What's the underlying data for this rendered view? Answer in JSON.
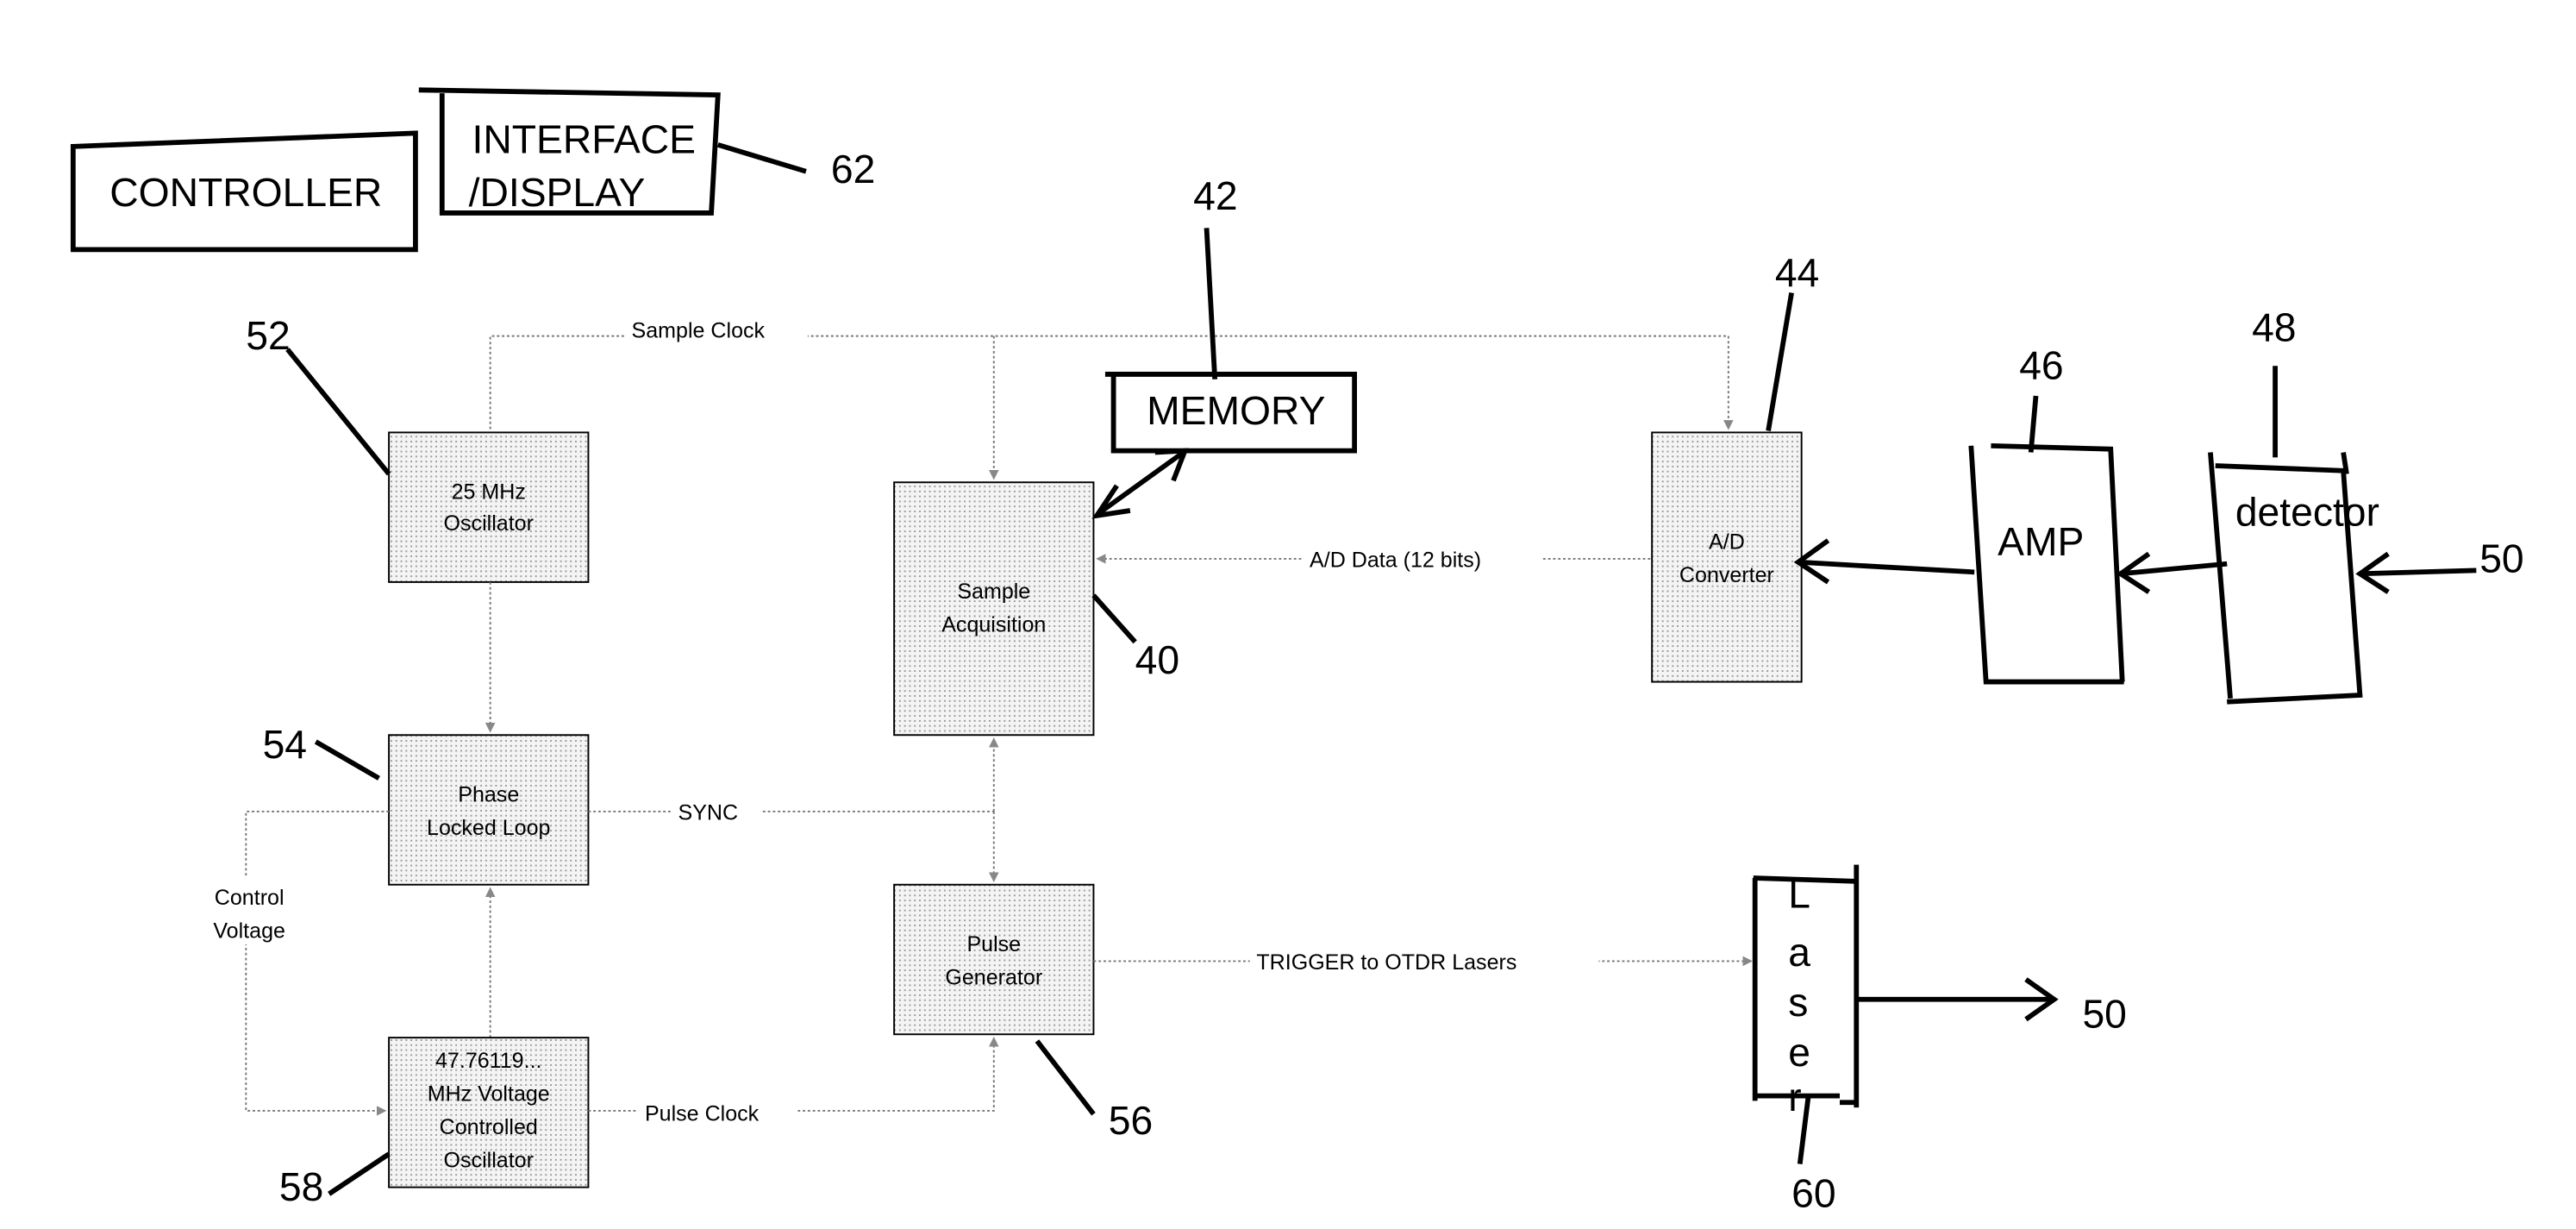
{
  "diagram": {
    "type": "block-diagram",
    "blocks": {
      "controller": "CONTROLLER",
      "interface_line1": "INTERFACE",
      "interface_line2": "/DISPLAY",
      "memory": "MEMORY",
      "oscillator_line1": "25 MHz",
      "oscillator_line2": "Oscillator",
      "pll_line1": "Phase",
      "pll_line2": "Locked Loop",
      "vco_line1": "47.76119...",
      "vco_line2": "MHz Voltage",
      "vco_line3": "Controlled",
      "vco_line4": "Oscillator",
      "sample_line1": "Sample",
      "sample_line2": "Acquisition",
      "pulse_line1": "Pulse",
      "pulse_line2": "Generator",
      "adc_line1": "A/D",
      "adc_line2": "Converter",
      "amp": "AMP",
      "detector": "detector",
      "laser_letters": [
        "L",
        "a",
        "s",
        "e",
        "r"
      ]
    },
    "signals": {
      "sample_clock": "Sample Clock",
      "ad_data": "A/D Data (12 bits)",
      "sync": "SYNC",
      "control_voltage_line1": "Control",
      "control_voltage_line2": "Voltage",
      "pulse_clock": "Pulse Clock",
      "trigger": "TRIGGER to OTDR Lasers"
    },
    "reference_numerals": {
      "interface": "62",
      "memory": "42",
      "adc": "44",
      "amp": "46",
      "detector": "48",
      "fiber_in": "50",
      "fiber_out": "50",
      "oscillator": "52",
      "pll": "54",
      "sample": "40",
      "pulse": "56",
      "vco": "58",
      "laser": "60"
    }
  }
}
